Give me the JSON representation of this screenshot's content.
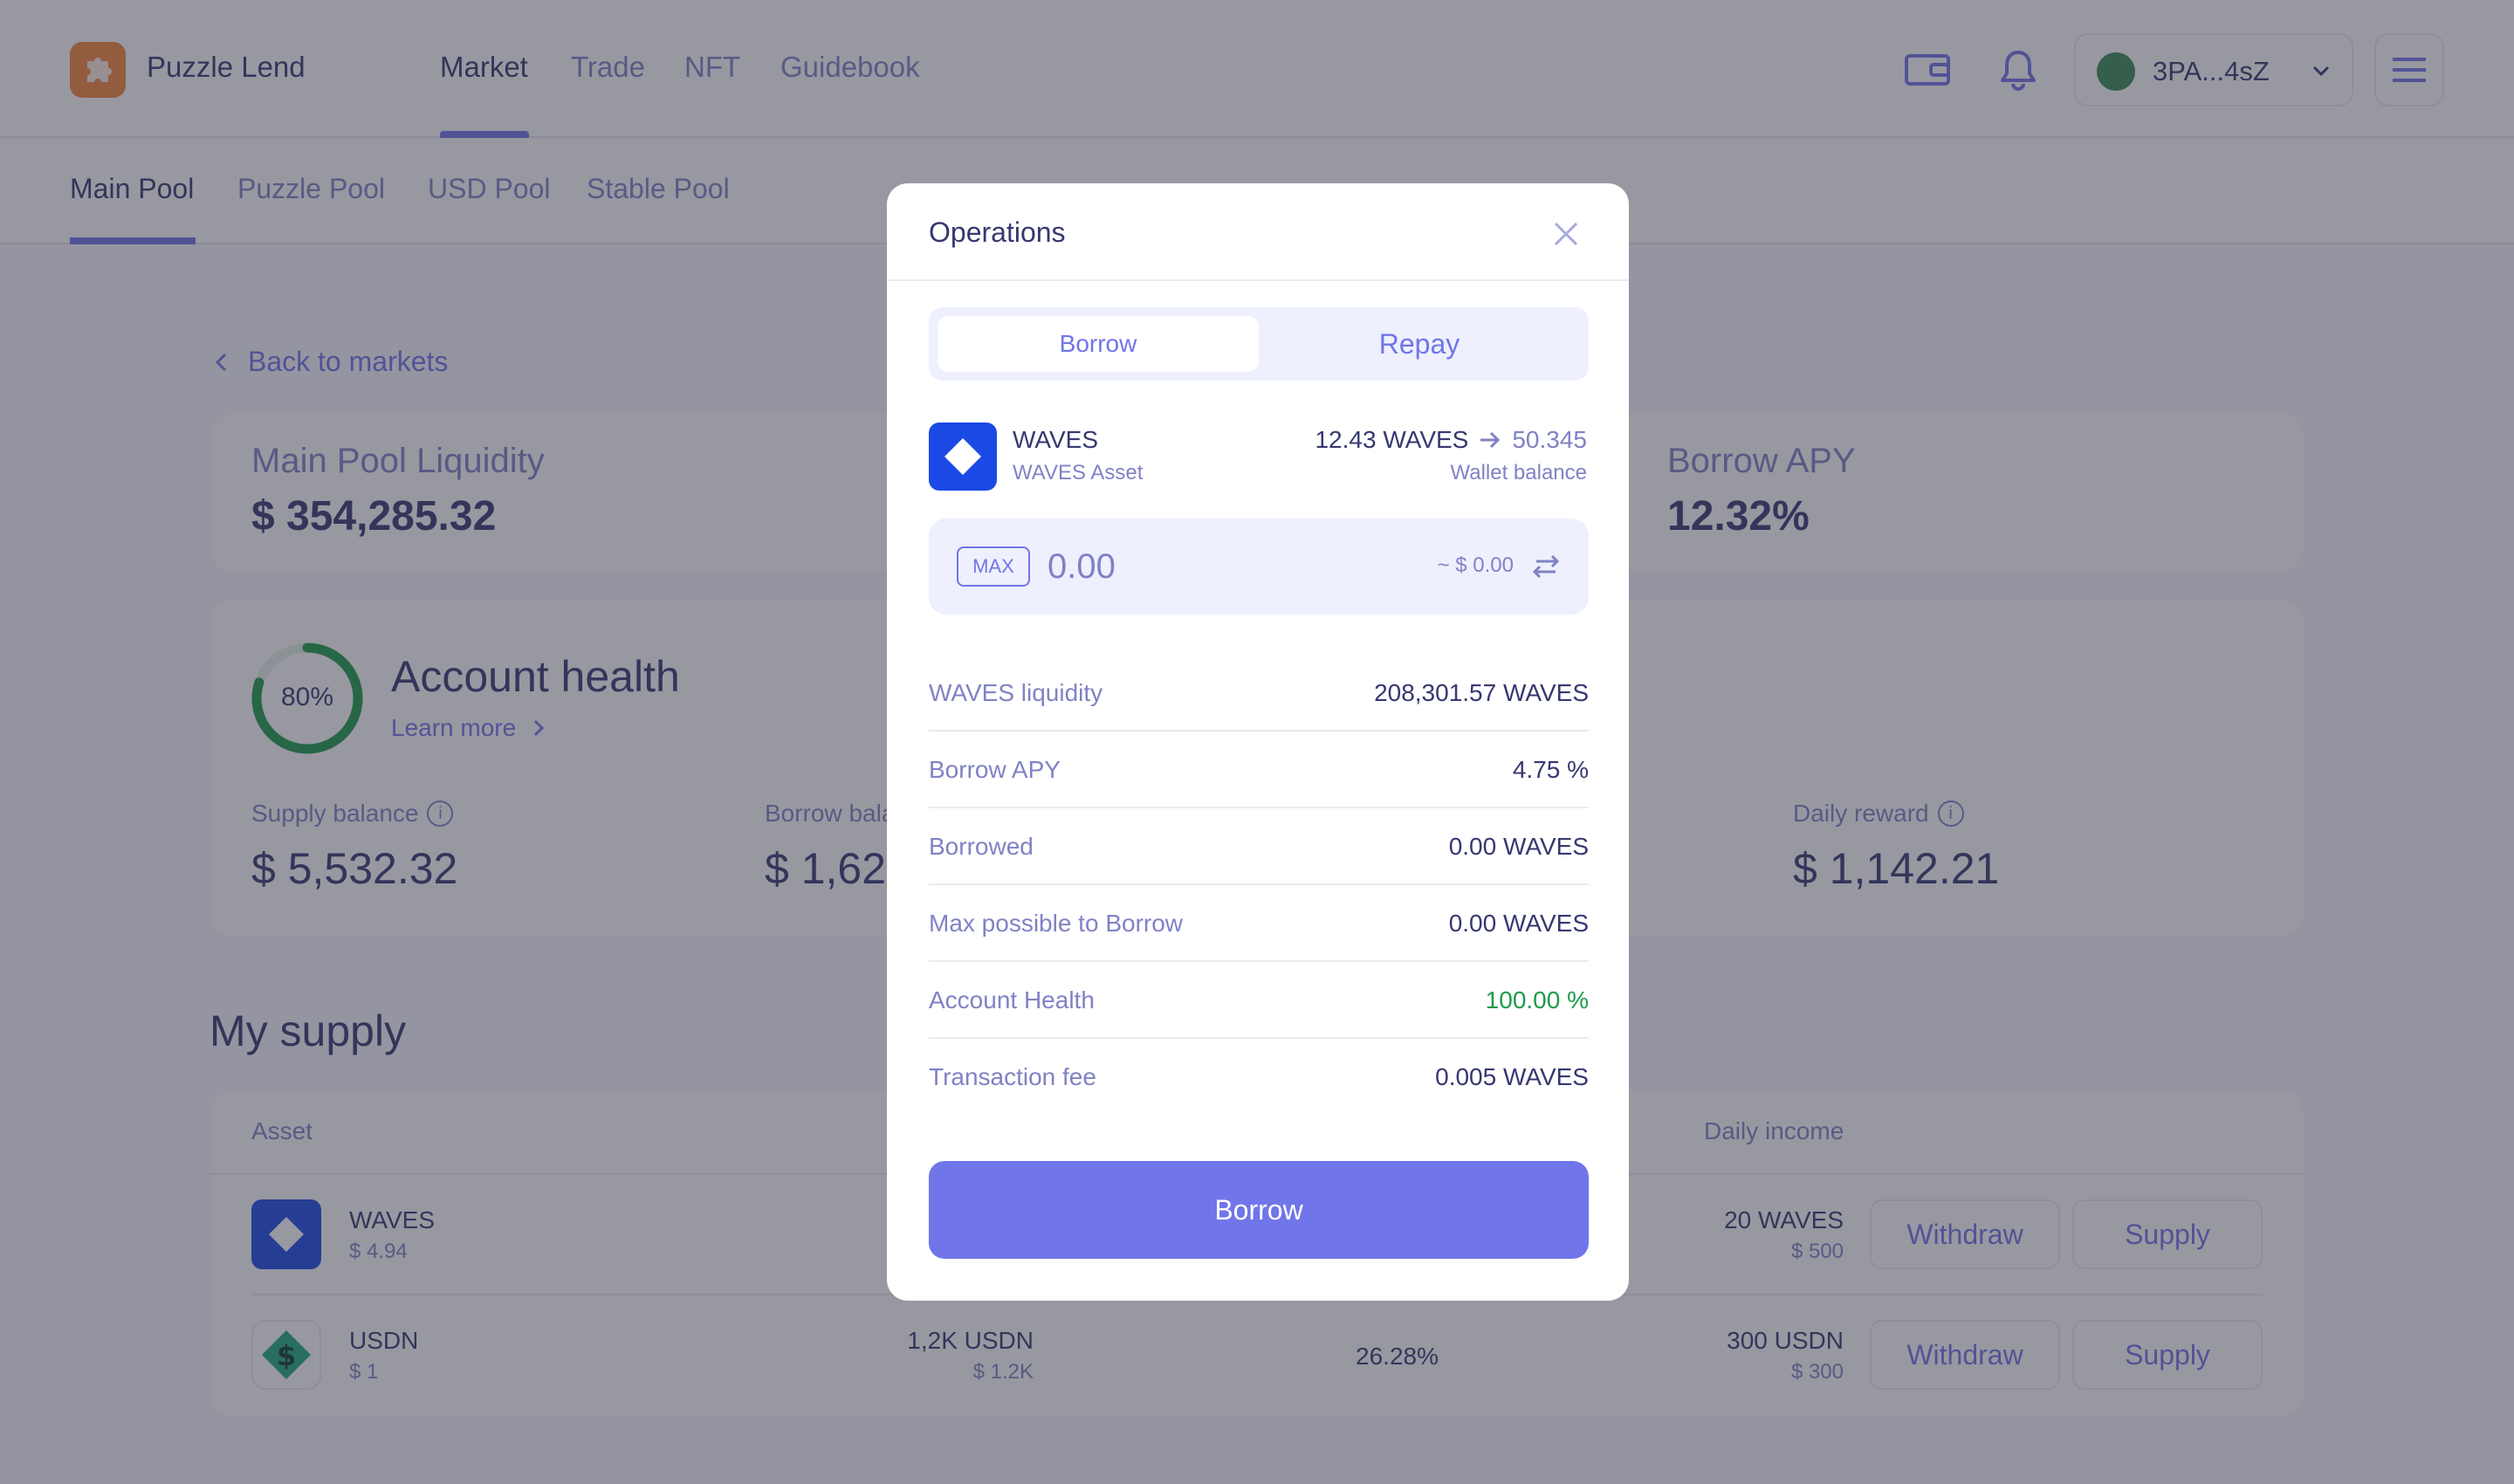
{
  "header": {
    "app_name": "Puzzle Lend",
    "nav": [
      "Market",
      "Trade",
      "NFT",
      "Guidebook"
    ],
    "account": "3PA...4sZ"
  },
  "pools": [
    "Main Pool",
    "Puzzle Pool",
    "USD Pool",
    "Stable Pool"
  ],
  "back_label": "Back to markets",
  "stats": {
    "liquidity_label": "Main Pool Liquidity",
    "liquidity_value": "$ 354,285.32",
    "borrow_apy_label": "Borrow APY",
    "borrow_apy_value": "12.32%"
  },
  "health": {
    "percent": "80%",
    "percent_value": 80,
    "title": "Account health",
    "learn_more": "Learn more",
    "supply_label": "Supply balance",
    "supply_value": "$ 5,532.32",
    "borrow_label": "Borrow bala",
    "borrow_value": "$ 1,62",
    "daily_label": "Daily reward",
    "daily_value": "$ 1,142.21"
  },
  "supply": {
    "title": "My supply",
    "col_asset": "Asset",
    "col_income": "Daily income",
    "rows": [
      {
        "name": "WAVES",
        "price": "$ 4.94",
        "income": "20 WAVES",
        "income_usd": "$ 500",
        "withdraw": "Withdraw",
        "supply": "Supply"
      },
      {
        "name": "USDN",
        "price": "$ 1",
        "amount": "1,2K USDN",
        "amount_usd": "$ 1.2K",
        "apy": "26.28%",
        "income": "300 USDN",
        "income_usd": "$ 300",
        "withdraw": "Withdraw",
        "supply": "Supply"
      }
    ]
  },
  "modal": {
    "title": "Operations",
    "tab_active": "Borrow",
    "tab_inactive": "Repay",
    "token_name": "WAVES",
    "token_sub": "WAVES Asset",
    "balance": "12.43 WAVES",
    "new_balance": "50.345",
    "balance_label": "Wallet balance",
    "max_label": "MAX",
    "amount_placeholder": "0.00",
    "amount_usd": "~ $ 0.00",
    "rows": [
      {
        "label": "WAVES liquidity",
        "value": "208,301.57 WAVES"
      },
      {
        "label": "Borrow APY",
        "value": "4.75 %"
      },
      {
        "label": "Borrowed",
        "value": "0.00 WAVES"
      },
      {
        "label": "Max possible to Borrow",
        "value": "0.00 WAVES"
      },
      {
        "label": "Account Health",
        "value": "100.00 %"
      },
      {
        "label": "Transaction fee",
        "value": "0.005 WAVES"
      }
    ],
    "action": "Borrow"
  },
  "colors": {
    "accent": "#7075e9",
    "text": "#363870",
    "muted": "#8082c5",
    "green": "#1d9b49",
    "waves": "#1b49e5",
    "logo": "#f4863b"
  }
}
